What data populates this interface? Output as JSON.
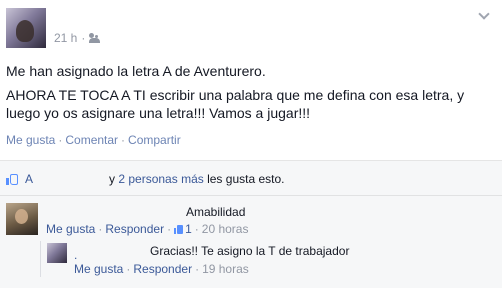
{
  "post": {
    "time": "21 h",
    "body": [
      "Me han asignado la letra A de Aventurero.",
      "AHORA TE TOCA A TI escribir una palabra que me defina con esa letra, y luego yo os asignare una letra!!! Vamos a jugar!!!"
    ],
    "actions": [
      "Me gusta",
      "Comentar",
      "Compartir"
    ]
  },
  "likes": {
    "liker": "A",
    "conjunction": "y",
    "count_link": "2 personas más",
    "tail": "les gusta esto."
  },
  "comments": [
    {
      "author": "",
      "text": "Amabilidad",
      "like_label": "Me gusta",
      "reply_label": "Responder",
      "likes": "1",
      "time": "20 horas"
    },
    {
      "author": ".",
      "text": "Gracias!! Te asigno la T de trabajador",
      "like_label": "Me gusta",
      "reply_label": "Responder",
      "time": "19 horas"
    }
  ],
  "colors": {
    "link": "#3b5998",
    "muted": "#9197a3",
    "ufi_bg": "#f6f7f8"
  }
}
